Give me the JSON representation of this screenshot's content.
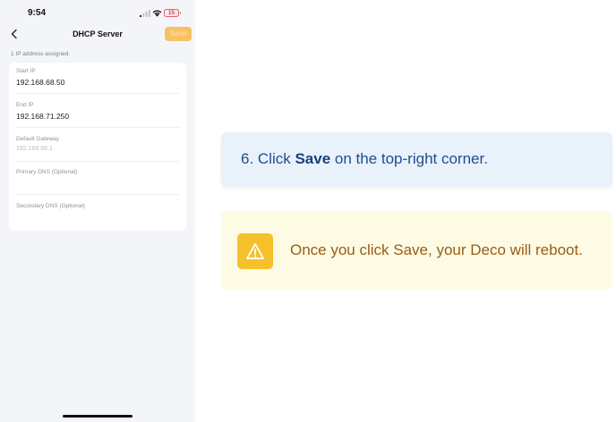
{
  "status_bar": {
    "time": "9:54",
    "battery": "15"
  },
  "nav": {
    "title": "DHCP Server",
    "save_label": "Save"
  },
  "assigned_text": "1 IP address assigned.",
  "fields": [
    {
      "label": "Start IP",
      "value": "192.168.68.50"
    },
    {
      "label": "End IP",
      "value": "192.168.71.250"
    },
    {
      "label": "Default Gateway",
      "value": "192.168.68.1"
    },
    {
      "label": "Primary DNS (Optional)",
      "value": ""
    },
    {
      "label": "Secondary DNS (Optional)",
      "value": ""
    }
  ],
  "instruction": {
    "prefix": "6. Click ",
    "bold": "Save",
    "suffix": " on the top-right corner."
  },
  "warning": {
    "icon": "warning-triangle-icon",
    "text": "Once you click Save, your Deco will reboot."
  },
  "colors": {
    "accent": "#f9c165",
    "instruction_bg": "#e9f1fb",
    "warning_bg": "#fdfbe3",
    "warning_icon_bg": "#f6c02a",
    "warning_text": "#9a5c16"
  }
}
